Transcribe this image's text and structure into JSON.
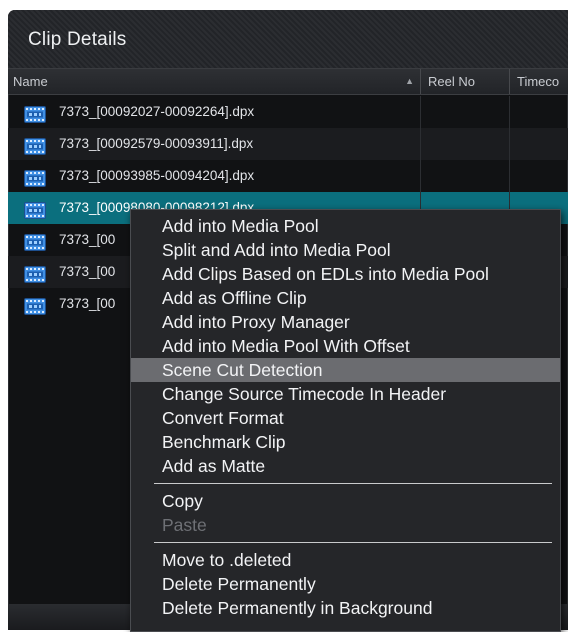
{
  "panel": {
    "title": "Clip Details"
  },
  "columns": {
    "name": "Name",
    "reel": "Reel No",
    "timecode": "Timeco"
  },
  "rows": [
    {
      "label": "7373_[00092027-00092264].dpx",
      "selected": false
    },
    {
      "label": "7373_[00092579-00093911].dpx",
      "selected": false
    },
    {
      "label": "7373_[00093985-00094204].dpx",
      "selected": false
    },
    {
      "label": "7373_[00098080-00098212].dpx",
      "selected": true
    },
    {
      "label": "7373_[00",
      "selected": false
    },
    {
      "label": "7373_[00",
      "selected": false
    },
    {
      "label": "7373_[00",
      "selected": false
    }
  ],
  "menu": {
    "group1": [
      "Add into Media Pool",
      "Split and Add into Media Pool",
      "Add Clips Based on EDLs into Media Pool",
      "Add as Offline Clip",
      "Add into Proxy Manager",
      "Add into Media Pool With Offset",
      "Scene Cut Detection",
      "Change Source Timecode In Header",
      "Convert Format",
      "Benchmark Clip",
      "Add as Matte"
    ],
    "group2": [
      "Copy",
      "Paste"
    ],
    "group3": [
      "Move to .deleted",
      "Delete Permanently",
      "Delete Permanently in Background"
    ],
    "highlighted": "Scene Cut Detection",
    "disabled": "Paste"
  },
  "icons": {
    "clip": "dpx-sequence-icon",
    "sort": "sort-ascending-icon"
  },
  "colors": {
    "selected_row": "#0b6f7e",
    "menu_highlight": "#6b6c70"
  }
}
